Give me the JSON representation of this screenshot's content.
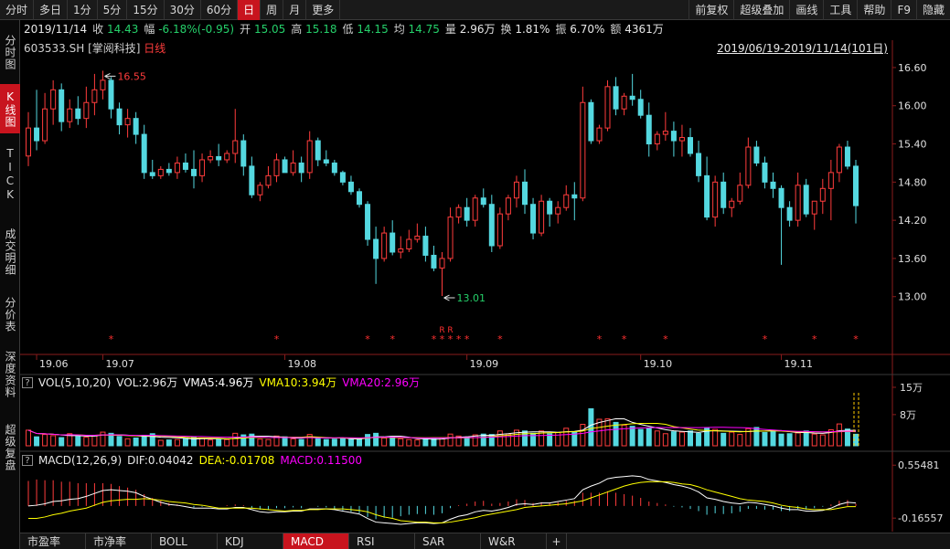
{
  "toolbar": {
    "left": [
      "分时",
      "多日",
      "1分",
      "5分",
      "15分",
      "30分",
      "60分",
      "日",
      "周",
      "月",
      "更多"
    ],
    "active_index": 7,
    "right": [
      "前复权",
      "超级叠加",
      "画线",
      "工具",
      "帮助",
      "F9",
      "隐藏"
    ]
  },
  "sidebar": {
    "items": [
      "分时图",
      "K线图",
      "TICK",
      "成交明细",
      "分价表",
      "深度资料",
      "超级复盘"
    ],
    "active_index": 1
  },
  "quote": {
    "date": "2019/11/14",
    "close_label": "收",
    "close": "14.43",
    "change_label": "幅",
    "change": "-6.18%(-0.95)",
    "open_label": "开",
    "open": "15.05",
    "high_label": "高",
    "high": "15.18",
    "low_label": "低",
    "low": "14.15",
    "avg_label": "均",
    "avg": "14.75",
    "volume_label": "量",
    "volume": "2.96万",
    "turnover_label": "换",
    "turnover": "1.81%",
    "amplitude_label": "振",
    "amplitude": "6.70%",
    "amount_label": "额",
    "amount": "4361万"
  },
  "stock": {
    "code": "603533.SH",
    "name": "[掌阅科技]",
    "period": "日线"
  },
  "date_range": "2019/06/19-2019/11/14(101日)",
  "annotations": {
    "high_marker": "16.55",
    "low_marker": "13.01",
    "r_marks": [
      "R",
      "R"
    ]
  },
  "volume_panel": {
    "title": "VOL(5,10,20)",
    "vol_label": "VOL:2.96万",
    "vma5_label": "VMA5:4.96万",
    "vma10_label": "VMA10:3.94万",
    "vma20_label": "VMA20:2.96万",
    "ticks": [
      "15万",
      "8万"
    ],
    "colors": {
      "vma5": "#ffffff",
      "vma10": "#ffff00",
      "vma20": "#ff00ff"
    }
  },
  "macd_panel": {
    "title": "MACD(12,26,9)",
    "dif_label": "DIF:0.04042",
    "dea_label": "DEA:-0.01708",
    "macd_label": "MACD:0.11500",
    "ticks": [
      "0.55481",
      "-0.16557"
    ],
    "colors": {
      "dif": "#ffffff",
      "dea": "#ffff00",
      "macd": "#ff00ff"
    }
  },
  "tabs": [
    "市盈率",
    "市净率",
    "BOLL",
    "KDJ",
    "MACD",
    "RSI",
    "SAR",
    "W&R"
  ],
  "tabs_active_index": 4,
  "colors": {
    "up": "#ff3c3c",
    "down": "#54d8e0",
    "accent": "#c8141e"
  },
  "chart_data": {
    "type": "candlestick",
    "date_range": "2019/06/19-2019/11/14",
    "y_ticks": [
      13.0,
      13.6,
      14.2,
      14.8,
      15.4,
      16.0,
      16.6
    ],
    "ylim": [
      12.58,
      16.8
    ],
    "x_ticks": [
      {
        "label": "19.06",
        "index": 1
      },
      {
        "label": "19.07",
        "index": 9
      },
      {
        "label": "19.08",
        "index": 31
      },
      {
        "label": "19.09",
        "index": 53
      },
      {
        "label": "19.10",
        "index": 74
      },
      {
        "label": "19.11",
        "index": 91
      }
    ],
    "star_indices": [
      10,
      30,
      41,
      44,
      49,
      50,
      51,
      52,
      53,
      57,
      69,
      72,
      77,
      89,
      95,
      100
    ],
    "ohlc": [
      [
        15.21,
        15.9,
        15.05,
        15.65
      ],
      [
        15.65,
        16.25,
        15.3,
        15.45
      ],
      [
        15.45,
        16.2,
        15.4,
        15.95
      ],
      [
        15.95,
        16.4,
        15.7,
        16.25
      ],
      [
        16.25,
        16.35,
        15.6,
        15.75
      ],
      [
        15.75,
        16.1,
        15.65,
        15.95
      ],
      [
        15.95,
        16.15,
        15.7,
        15.8
      ],
      [
        15.8,
        16.3,
        15.65,
        16.05
      ],
      [
        16.05,
        16.5,
        15.85,
        16.25
      ],
      [
        16.25,
        16.55,
        16.1,
        16.4
      ],
      [
        16.4,
        16.45,
        15.8,
        15.95
      ],
      [
        15.95,
        16.05,
        15.55,
        15.7
      ],
      [
        15.7,
        15.95,
        15.5,
        15.8
      ],
      [
        15.8,
        15.9,
        15.4,
        15.55
      ],
      [
        15.55,
        15.7,
        14.85,
        14.95
      ],
      [
        14.95,
        15.15,
        14.85,
        14.9
      ],
      [
        14.9,
        15.05,
        14.85,
        15.0
      ],
      [
        15.0,
        15.1,
        14.9,
        14.95
      ],
      [
        14.95,
        15.2,
        14.85,
        15.1
      ],
      [
        15.1,
        15.25,
        14.95,
        15.0
      ],
      [
        15.0,
        15.3,
        14.7,
        14.9
      ],
      [
        14.9,
        15.25,
        14.8,
        15.15
      ],
      [
        15.15,
        15.3,
        15.1,
        15.2
      ],
      [
        15.2,
        15.4,
        15.05,
        15.15
      ],
      [
        15.15,
        15.3,
        15.1,
        15.25
      ],
      [
        15.25,
        15.95,
        15.1,
        15.45
      ],
      [
        15.45,
        15.55,
        14.9,
        15.05
      ],
      [
        15.05,
        15.2,
        14.55,
        14.6
      ],
      [
        14.6,
        14.8,
        14.5,
        14.75
      ],
      [
        14.75,
        15.05,
        14.7,
        14.9
      ],
      [
        14.9,
        15.25,
        14.8,
        15.15
      ],
      [
        15.15,
        15.2,
        14.95,
        14.95
      ],
      [
        14.95,
        15.3,
        14.9,
        15.1
      ],
      [
        15.1,
        15.2,
        14.8,
        14.95
      ],
      [
        14.95,
        15.6,
        14.85,
        15.45
      ],
      [
        15.45,
        15.5,
        15.05,
        15.15
      ],
      [
        15.15,
        15.3,
        15.05,
        15.1
      ],
      [
        15.1,
        15.15,
        14.9,
        14.95
      ],
      [
        14.95,
        14.98,
        14.75,
        14.8
      ],
      [
        14.8,
        14.9,
        14.6,
        14.65
      ],
      [
        14.65,
        14.7,
        14.4,
        14.45
      ],
      [
        14.45,
        14.5,
        13.8,
        13.9
      ],
      [
        13.9,
        14.1,
        13.2,
        13.6
      ],
      [
        13.6,
        14.1,
        13.55,
        14.0
      ],
      [
        14.0,
        14.2,
        13.65,
        13.7
      ],
      [
        13.7,
        13.95,
        13.6,
        13.75
      ],
      [
        13.75,
        14.05,
        13.7,
        13.9
      ],
      [
        13.9,
        14.15,
        13.85,
        13.95
      ],
      [
        13.95,
        14.1,
        13.55,
        13.65
      ],
      [
        13.65,
        13.8,
        13.4,
        13.45
      ],
      [
        13.45,
        13.7,
        13.01,
        13.6
      ],
      [
        13.6,
        14.4,
        13.55,
        14.25
      ],
      [
        14.25,
        14.45,
        14.15,
        14.4
      ],
      [
        14.4,
        14.55,
        14.1,
        14.2
      ],
      [
        14.2,
        14.6,
        14.1,
        14.55
      ],
      [
        14.55,
        14.7,
        14.4,
        14.45
      ],
      [
        14.45,
        14.6,
        13.7,
        13.8
      ],
      [
        13.8,
        14.4,
        13.75,
        14.3
      ],
      [
        14.3,
        14.6,
        14.2,
        14.55
      ],
      [
        14.55,
        14.9,
        14.4,
        14.8
      ],
      [
        14.8,
        15.0,
        14.3,
        14.45
      ],
      [
        14.45,
        14.55,
        13.9,
        14.0
      ],
      [
        14.0,
        14.6,
        13.95,
        14.5
      ],
      [
        14.5,
        14.55,
        14.1,
        14.3
      ],
      [
        14.3,
        14.5,
        14.15,
        14.4
      ],
      [
        14.4,
        14.75,
        14.35,
        14.6
      ],
      [
        14.6,
        14.8,
        14.2,
        14.55
      ],
      [
        14.55,
        16.3,
        14.5,
        16.05
      ],
      [
        16.05,
        16.1,
        15.4,
        15.45
      ],
      [
        15.45,
        15.7,
        15.4,
        15.65
      ],
      [
        15.65,
        16.4,
        15.6,
        16.3
      ],
      [
        16.3,
        16.45,
        15.85,
        15.95
      ],
      [
        15.95,
        16.2,
        15.85,
        16.15
      ],
      [
        16.15,
        16.5,
        16.0,
        16.1
      ],
      [
        16.1,
        16.25,
        15.8,
        15.85
      ],
      [
        15.85,
        16.05,
        15.2,
        15.4
      ],
      [
        15.4,
        15.6,
        15.3,
        15.55
      ],
      [
        15.55,
        15.9,
        15.45,
        15.6
      ],
      [
        15.6,
        15.75,
        15.2,
        15.45
      ],
      [
        15.45,
        15.7,
        15.2,
        15.5
      ],
      [
        15.5,
        15.65,
        15.2,
        15.25
      ],
      [
        15.25,
        15.45,
        14.8,
        14.9
      ],
      [
        14.9,
        15.2,
        14.2,
        14.25
      ],
      [
        14.25,
        14.9,
        14.1,
        14.8
      ],
      [
        14.8,
        14.95,
        14.3,
        14.4
      ],
      [
        14.4,
        14.55,
        14.25,
        14.5
      ],
      [
        14.5,
        14.95,
        14.45,
        14.75
      ],
      [
        14.75,
        15.5,
        14.7,
        15.35
      ],
      [
        15.35,
        15.45,
        15.05,
        15.1
      ],
      [
        15.1,
        15.2,
        14.7,
        14.8
      ],
      [
        14.8,
        14.95,
        14.55,
        14.7
      ],
      [
        14.7,
        14.75,
        13.5,
        14.4
      ],
      [
        14.4,
        14.5,
        14.1,
        14.2
      ],
      [
        14.2,
        14.95,
        14.1,
        14.75
      ],
      [
        14.75,
        14.85,
        14.25,
        14.3
      ],
      [
        14.3,
        14.5,
        14.05,
        14.5
      ],
      [
        14.5,
        14.85,
        14.3,
        14.7
      ],
      [
        14.7,
        15.15,
        14.2,
        14.95
      ],
      [
        14.95,
        15.4,
        14.8,
        15.35
      ],
      [
        15.35,
        15.45,
        15.0,
        15.05
      ],
      [
        15.05,
        15.15,
        14.15,
        14.43
      ]
    ],
    "volume_ylim": [
      0,
      15
    ],
    "volume": [
      4.0,
      2.3,
      2.9,
      2.6,
      2.1,
      3.1,
      2.4,
      2.2,
      2.7,
      3.5,
      3.2,
      2.4,
      1.8,
      2.0,
      2.7,
      3.1,
      1.4,
      1.5,
      1.6,
      1.9,
      2.2,
      1.9,
      1.5,
      1.6,
      1.6,
      3.2,
      2.8,
      3.0,
      1.7,
      1.6,
      2.5,
      2.3,
      1.8,
      1.6,
      2.9,
      2.1,
      1.6,
      1.7,
      1.9,
      1.6,
      1.8,
      2.9,
      3.2,
      2.0,
      2.4,
      1.8,
      1.6,
      1.5,
      1.7,
      1.8,
      2.0,
      3.0,
      2.5,
      2.2,
      2.8,
      3.0,
      2.9,
      3.8,
      3.0,
      4.0,
      3.8,
      3.2,
      3.8,
      3.1,
      3.4,
      4.5,
      3.6,
      5.5,
      9.5,
      6.8,
      6.9,
      6.0,
      5.3,
      5.0,
      4.2,
      4.5,
      3.8,
      3.1,
      3.6,
      3.5,
      3.8,
      3.2,
      4.6,
      4.2,
      3.2,
      3.5,
      2.9,
      4.4,
      4.7,
      3.4,
      4.0,
      3.0,
      3.1,
      3.3,
      3.8,
      3.0,
      2.8,
      4.1,
      5.6,
      4.3,
      2.96
    ],
    "macd_ylim": [
      -0.3,
      0.62
    ],
    "macd_hist": [
      0.34,
      0.36,
      0.35,
      0.35,
      0.33,
      0.33,
      0.31,
      0.31,
      0.31,
      0.31,
      0.3,
      0.27,
      0.25,
      0.22,
      0.16,
      0.11,
      0.07,
      0.04,
      0.02,
      0.0,
      -0.02,
      -0.01,
      0.0,
      0.0,
      0.01,
      0.02,
      0.01,
      -0.03,
      -0.05,
      -0.05,
      -0.03,
      -0.03,
      -0.02,
      -0.03,
      0.0,
      -0.01,
      -0.02,
      -0.04,
      -0.06,
      -0.08,
      -0.1,
      -0.15,
      -0.18,
      -0.16,
      -0.16,
      -0.14,
      -0.12,
      -0.11,
      -0.11,
      -0.12,
      -0.1,
      -0.03,
      0.01,
      0.03,
      0.06,
      0.07,
      0.03,
      0.04,
      0.06,
      0.09,
      0.08,
      0.04,
      0.05,
      0.04,
      0.05,
      0.07,
      0.07,
      0.18,
      0.18,
      0.18,
      0.2,
      0.18,
      0.16,
      0.14,
      0.11,
      0.06,
      0.04,
      0.02,
      -0.01,
      -0.02,
      -0.04,
      -0.07,
      -0.12,
      -0.1,
      -0.11,
      -0.1,
      -0.08,
      -0.04,
      -0.04,
      -0.05,
      -0.05,
      -0.07,
      -0.07,
      -0.04,
      -0.05,
      -0.03,
      -0.01,
      0.02,
      0.07,
      0.08,
      0.03
    ],
    "macd_dif": [
      0.0,
      0.01,
      0.03,
      0.06,
      0.07,
      0.09,
      0.1,
      0.13,
      0.17,
      0.21,
      0.22,
      0.21,
      0.2,
      0.18,
      0.13,
      0.09,
      0.05,
      0.02,
      0.01,
      -0.01,
      -0.03,
      -0.03,
      -0.03,
      -0.04,
      -0.04,
      -0.02,
      -0.02,
      -0.05,
      -0.08,
      -0.09,
      -0.08,
      -0.08,
      -0.07,
      -0.07,
      -0.04,
      -0.04,
      -0.04,
      -0.05,
      -0.07,
      -0.09,
      -0.11,
      -0.17,
      -0.22,
      -0.23,
      -0.24,
      -0.25,
      -0.24,
      -0.23,
      -0.23,
      -0.24,
      -0.23,
      -0.18,
      -0.14,
      -0.12,
      -0.08,
      -0.06,
      -0.07,
      -0.05,
      -0.02,
      0.02,
      0.03,
      0.02,
      0.04,
      0.04,
      0.06,
      0.08,
      0.1,
      0.22,
      0.27,
      0.31,
      0.37,
      0.39,
      0.4,
      0.41,
      0.4,
      0.36,
      0.34,
      0.32,
      0.29,
      0.27,
      0.24,
      0.19,
      0.11,
      0.09,
      0.06,
      0.04,
      0.03,
      0.05,
      0.04,
      0.02,
      0.0,
      -0.03,
      -0.05,
      -0.05,
      -0.07,
      -0.07,
      -0.06,
      -0.03,
      0.02,
      0.05,
      0.04
    ],
    "macd_dea": [
      -0.17,
      -0.17,
      -0.15,
      -0.12,
      -0.1,
      -0.07,
      -0.05,
      -0.03,
      0.01,
      0.05,
      0.07,
      0.08,
      0.09,
      0.09,
      0.1,
      0.09,
      0.08,
      0.06,
      0.05,
      0.04,
      0.02,
      0.01,
      -0.01,
      -0.03,
      -0.03,
      -0.03,
      -0.03,
      -0.03,
      -0.04,
      -0.05,
      -0.06,
      -0.07,
      -0.06,
      -0.06,
      -0.05,
      -0.05,
      -0.04,
      -0.04,
      -0.04,
      -0.05,
      -0.06,
      -0.08,
      -0.12,
      -0.15,
      -0.17,
      -0.2,
      -0.21,
      -0.22,
      -0.22,
      -0.23,
      -0.23,
      -0.22,
      -0.2,
      -0.18,
      -0.16,
      -0.13,
      -0.11,
      -0.09,
      -0.07,
      -0.05,
      -0.02,
      -0.01,
      0.0,
      0.01,
      0.02,
      0.03,
      0.05,
      0.07,
      0.11,
      0.15,
      0.19,
      0.23,
      0.27,
      0.3,
      0.32,
      0.33,
      0.33,
      0.33,
      0.32,
      0.3,
      0.29,
      0.26,
      0.22,
      0.19,
      0.16,
      0.13,
      0.1,
      0.08,
      0.07,
      0.06,
      0.04,
      0.01,
      -0.01,
      -0.02,
      -0.04,
      -0.05,
      -0.05,
      -0.05,
      -0.03,
      -0.01,
      -0.01
    ]
  }
}
